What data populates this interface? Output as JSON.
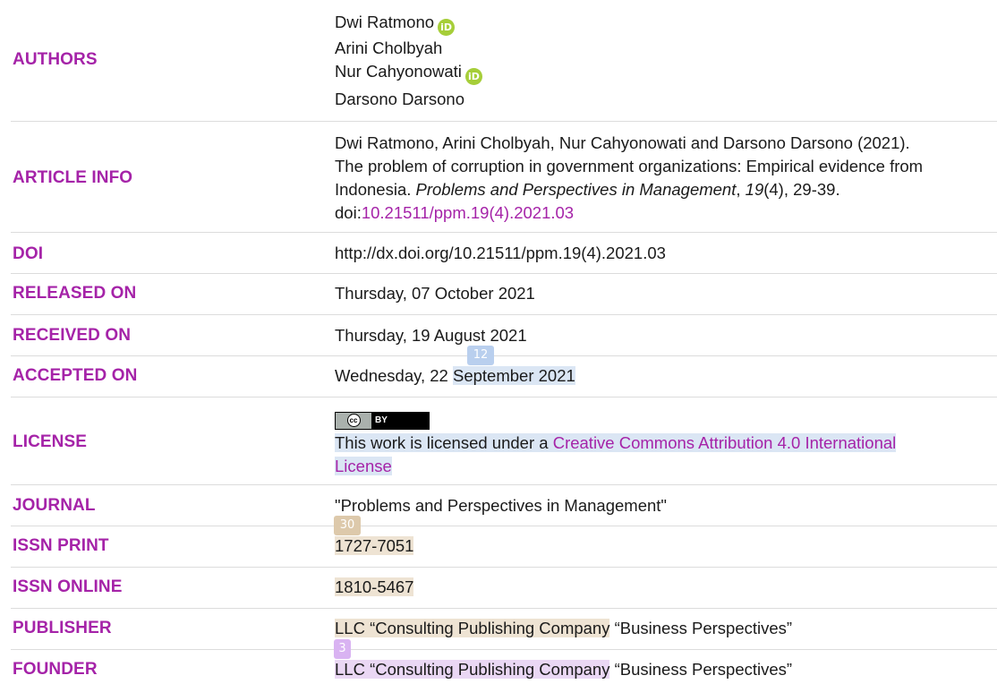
{
  "labels": {
    "authors": "AUTHORS",
    "article_info": "ARTICLE INFO",
    "doi": "DOI",
    "released_on": "RELEASED ON",
    "received_on": "RECEIVED ON",
    "accepted_on": "ACCEPTED ON",
    "license": "LICENSE",
    "journal": "JOURNAL",
    "issn_print": "ISSN PRINT",
    "issn_online": "ISSN ONLINE",
    "publisher": "PUBLISHER",
    "founder": "FOUNDER"
  },
  "authors": [
    "Dwi Ratmono",
    "Arini Cholbyah",
    "Nur Cahyonowati",
    "Darsono Darsono"
  ],
  "orcid_badge": "iD",
  "article_info": {
    "line1": "Dwi Ratmono, Arini Cholbyah, Nur Cahyonowati and Darsono Darsono (2021).",
    "line2": "The problem of corruption in government organizations: Empirical evidence from",
    "line3_pre": "Indonesia. ",
    "journal_italic": "Problems and Perspectives in Management",
    "sep": ", ",
    "volume_italic": "19",
    "line3_post": "(4), 29-39.",
    "doi_prefix": "doi:",
    "doi_link": "10.21511/ppm.19(4).2021.03"
  },
  "doi": "http://dx.doi.org/10.21511/ppm.19(4).2021.03",
  "released_on": "Thursday, 07 October 2021",
  "received_on": "Thursday, 19 August 2021",
  "accepted_on": {
    "pre": "Wednesday, 22 ",
    "highlight": "September 2021"
  },
  "license": {
    "badge_left": "cc",
    "badge_right": "BY",
    "text_pre": "This work is licensed under a ",
    "link_line1": "Creative Commons Attribution 4.0 International",
    "link_line2": "License"
  },
  "journal": "\"Problems and Perspectives in Management\"",
  "issn_print": "1727-7051",
  "issn_online": "1810-5467",
  "publisher": {
    "highlight": "LLC “Consulting Publishing Company",
    "rest": " “Business Perspectives”"
  },
  "founder": {
    "highlight": "LLC “Consulting Publishing Company",
    "rest": " “Business Perspectives”"
  },
  "markers": {
    "blue": "12",
    "tan": "30",
    "purple": "3"
  },
  "colors": {
    "label": "#a523a8",
    "link": "#a523a8",
    "orcid": "#a6ce39",
    "highlight_blue": "#dbe6f4",
    "highlight_tan": "#eee3d3",
    "highlight_purple": "#ead7f4"
  }
}
